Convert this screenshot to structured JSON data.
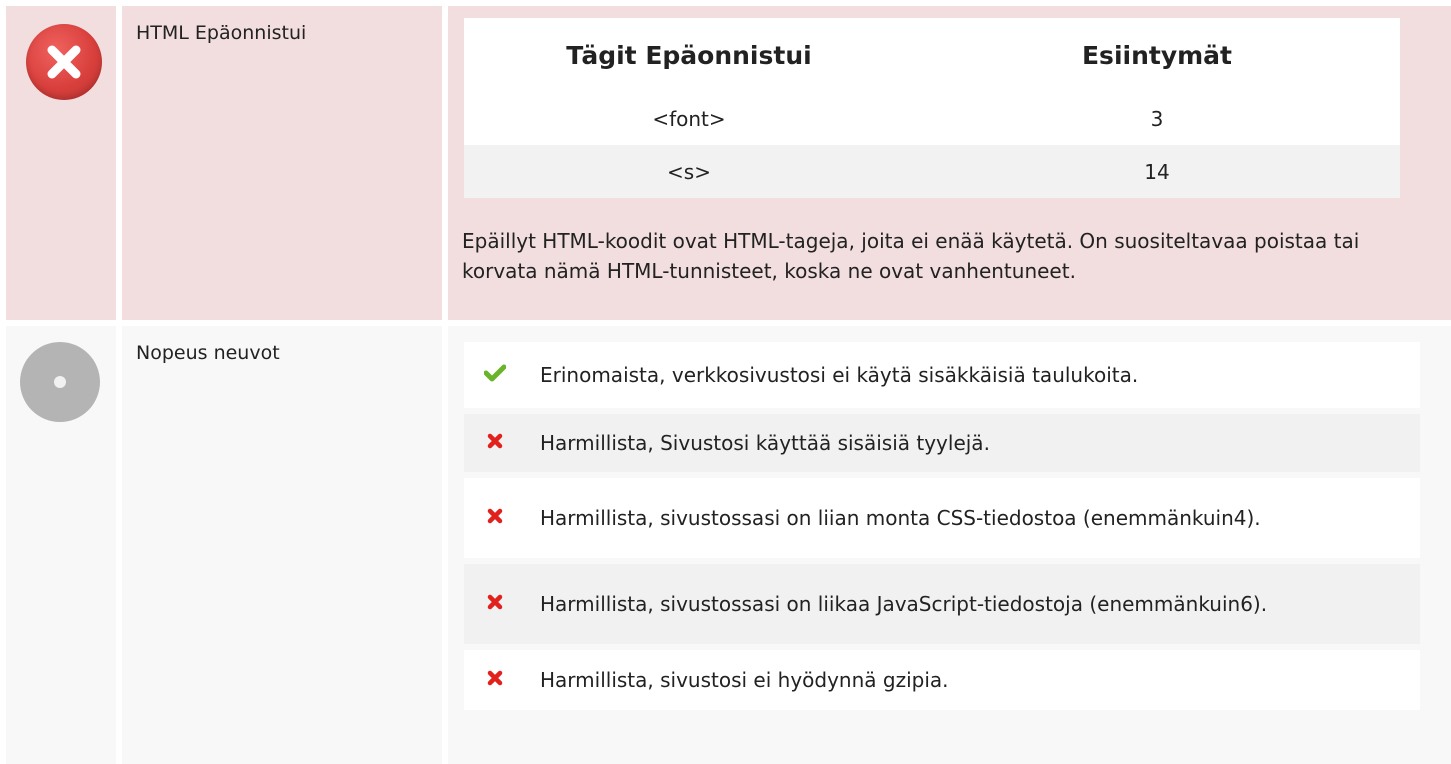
{
  "rows": [
    {
      "status_icon": "error-icon",
      "label": "HTML Epäonnistui",
      "table": {
        "headers": [
          "Tägit Epäonnistui",
          "Esiintymät"
        ],
        "rows": [
          [
            "<font>",
            "3"
          ],
          [
            "<s>",
            "14"
          ]
        ]
      },
      "note": "Epäillyt HTML-koodit ovat HTML-tageja, joita ei enää käytetä. On suositeltavaa poistaa tai korvata nämä HTML-tunnisteet, koska ne ovat vanhentuneet."
    },
    {
      "status_icon": "neutral-icon",
      "label": "Nopeus neuvot",
      "tips": [
        {
          "icon": "check-icon",
          "status": "pass",
          "text": "Erinomaista, verkkosivustosi ei käytä sisäkkäisiä taulukoita."
        },
        {
          "icon": "cross-icon",
          "status": "fail",
          "text": "Harmillista, Sivustosi käyttää sisäisiä tyylejä."
        },
        {
          "icon": "cross-icon",
          "status": "fail",
          "text": "Harmillista, sivustossasi on liian monta CSS-tiedostoa (enemmänkuin4)."
        },
        {
          "icon": "cross-icon",
          "status": "fail",
          "text": "Harmillista, sivustossasi on liikaa JavaScript-tiedostoja (enemmänkuin6)."
        },
        {
          "icon": "cross-icon",
          "status": "fail",
          "text": "Harmillista, sivustosi ei hyödynnä gzipia."
        }
      ]
    }
  ],
  "colors": {
    "error_row_bg": "#f2dedf",
    "neutral_row_bg": "#f8f8f8",
    "pass_green": "#6ab42b",
    "fail_red": "#e2211c",
    "error_icon_red": "#d9403d",
    "neutral_icon_gray": "#b4b4b4"
  }
}
